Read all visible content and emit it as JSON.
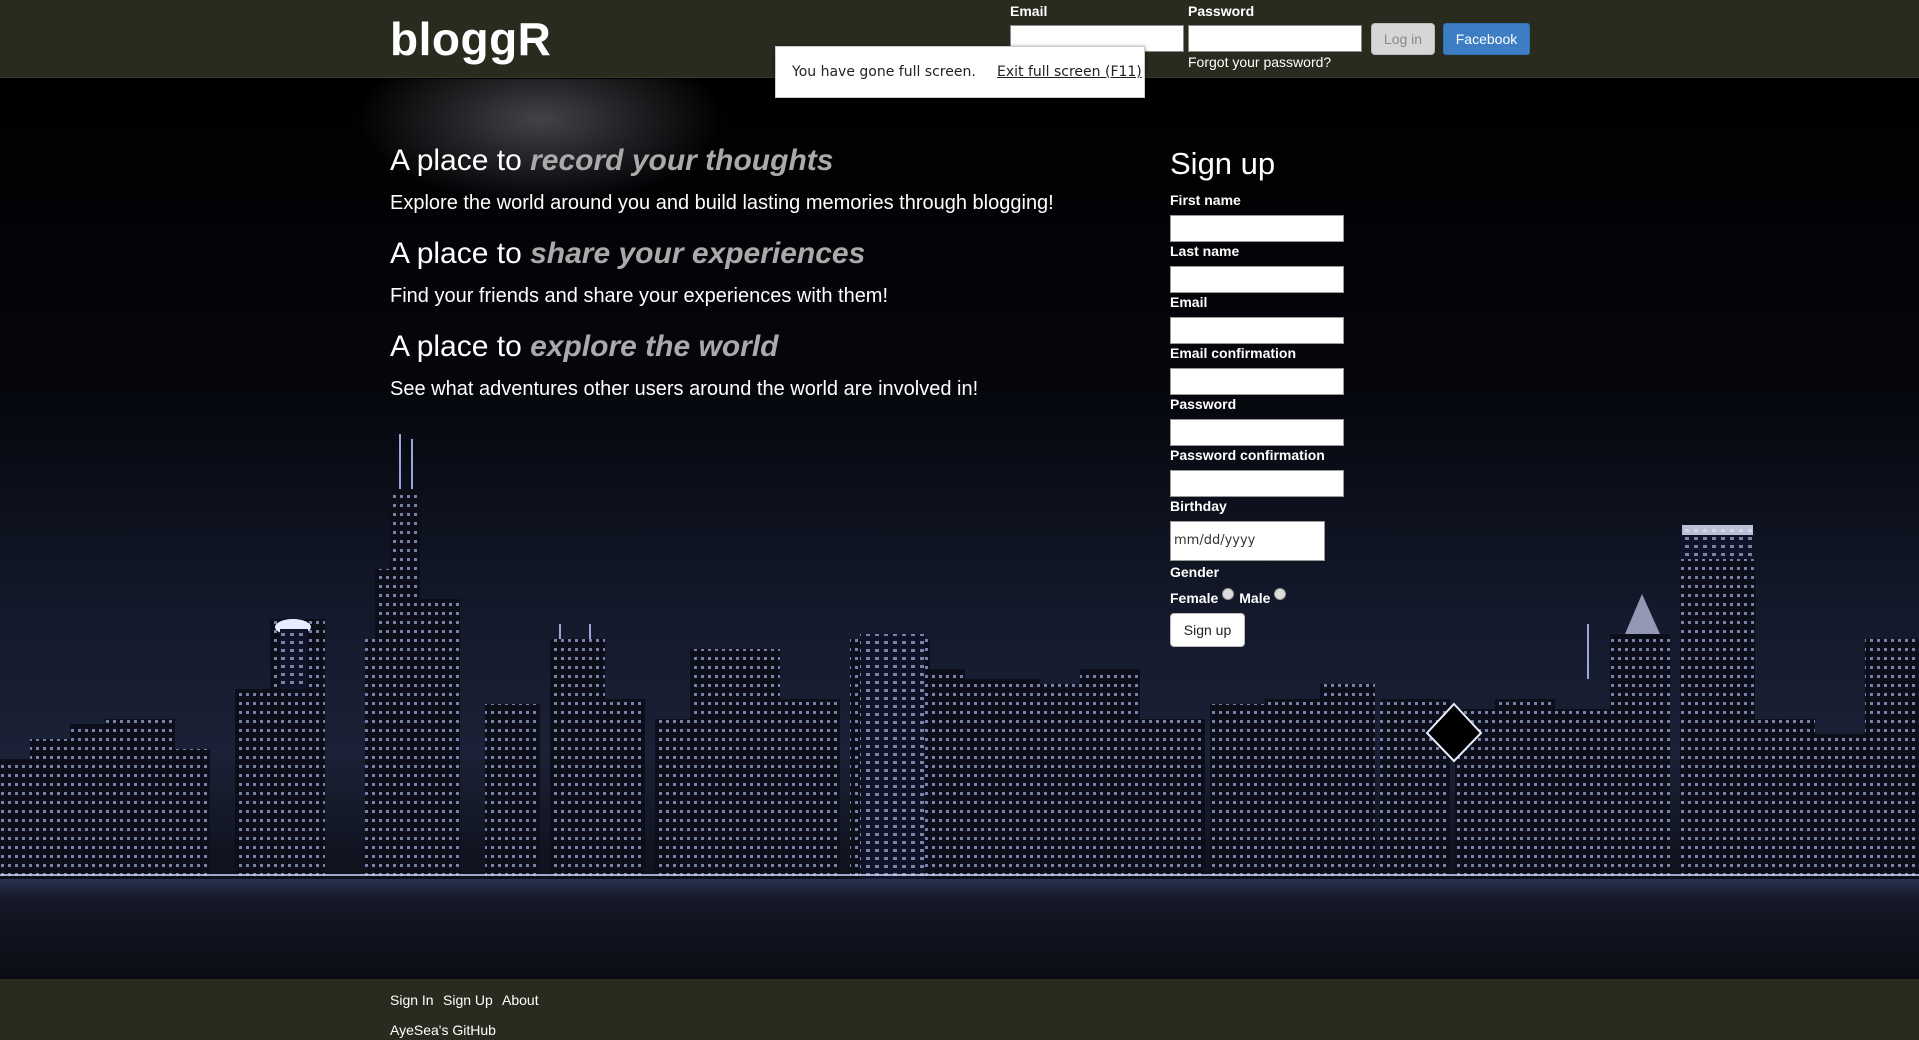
{
  "header": {
    "logo": "bloggR",
    "email_label": "Email",
    "password_label": "Password",
    "forgot_password": "Forgot your password?",
    "login_button": "Log in",
    "facebook_button": "Facebook"
  },
  "toast": {
    "message": "You have gone full screen.",
    "exit": "Exit full screen (F11)"
  },
  "taglines": [
    {
      "prefix": "A place to",
      "emphasis": "record your thoughts",
      "description": "Explore the world around you and build lasting memories through blogging!"
    },
    {
      "prefix": "A place to",
      "emphasis": "share your experiences",
      "description": "Find your friends and share your experiences with them!"
    },
    {
      "prefix": "A place to",
      "emphasis": "explore the world",
      "description": "See what adventures other users around the world are involved in!"
    }
  ],
  "signup": {
    "title": "Sign up",
    "fields": [
      {
        "label": "First name",
        "value": ""
      },
      {
        "label": "Last name",
        "value": ""
      },
      {
        "label": "Email",
        "value": ""
      },
      {
        "label": "Email confirmation",
        "value": ""
      },
      {
        "label": "Password",
        "value": ""
      },
      {
        "label": "Password confirmation",
        "value": ""
      }
    ],
    "birthday_label": "Birthday",
    "birthday_placeholder": "mm/dd/yyyy",
    "gender_label": "Gender",
    "female": "Female",
    "male": "Male",
    "submit": "Sign up"
  },
  "footer": {
    "links": [
      "Sign In",
      "Sign Up",
      "About"
    ],
    "github": "AyeSea's GitHub"
  },
  "colors": {
    "header_bg": "#2a2b1f",
    "facebook_blue": "#3d7dc4",
    "emphasis_gray": "#aaaaaa"
  }
}
